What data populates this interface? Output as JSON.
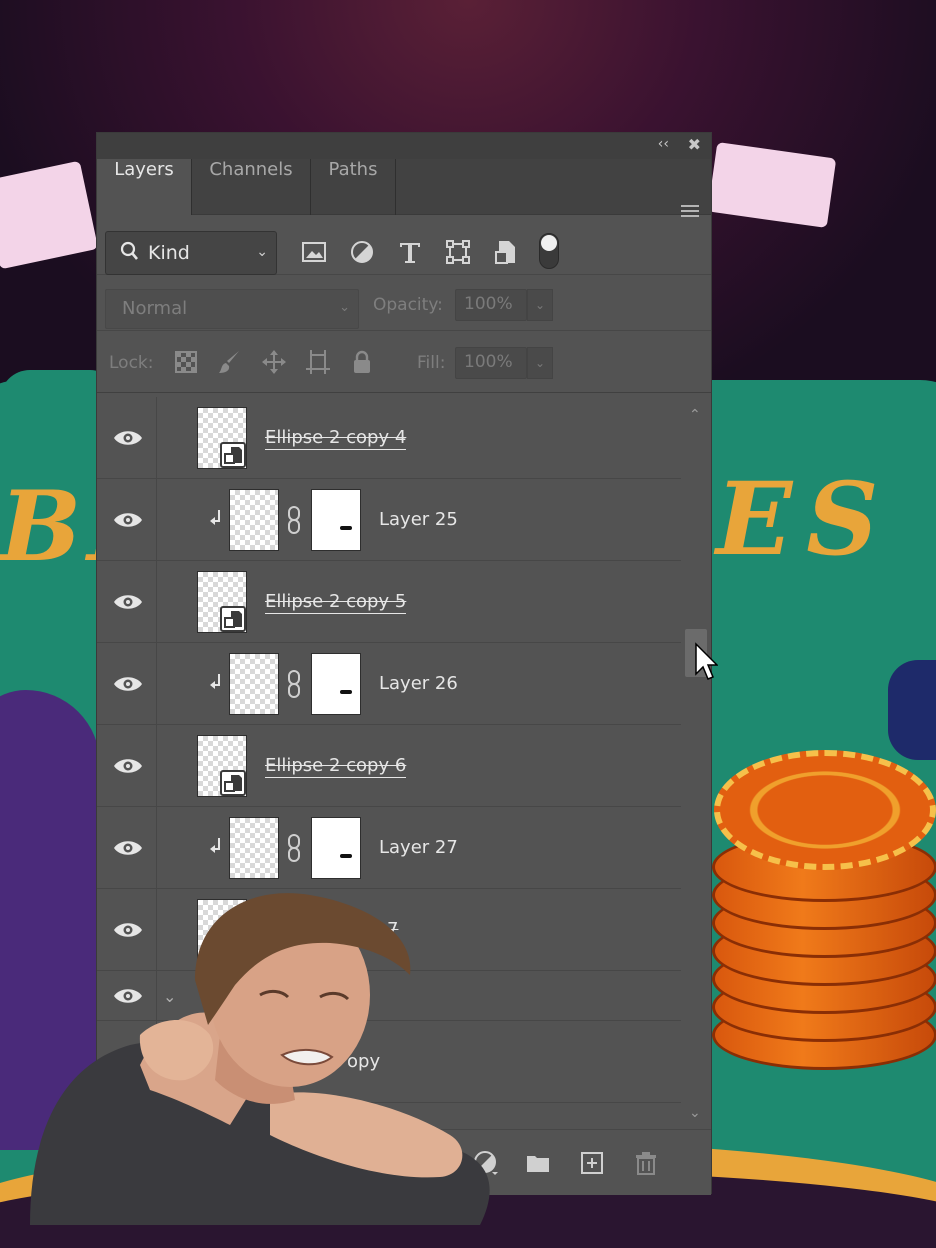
{
  "panel": {
    "collapse_glyph": "‹‹",
    "close_glyph": "✖",
    "tabs": [
      {
        "label": "Layers",
        "active": true
      },
      {
        "label": "Channels",
        "active": false
      },
      {
        "label": "Paths",
        "active": false
      }
    ],
    "menu_icon": "hamburger-menu-icon"
  },
  "filter": {
    "kind_label": "Kind",
    "icons": [
      "image-filter-icon",
      "adjustment-filter-icon",
      "type-filter-icon",
      "shape-filter-icon",
      "smartobject-filter-icon",
      "filter-toggle-icon"
    ]
  },
  "blend": {
    "mode": "Normal",
    "opacity_label": "Opacity:",
    "opacity_value": "100%"
  },
  "lock": {
    "label": "Lock:",
    "icons": [
      "lock-transparent-icon",
      "lock-pixels-icon",
      "lock-position-icon",
      "lock-artboard-icon",
      "lock-all-icon"
    ],
    "fill_label": "Fill:",
    "fill_value": "100%"
  },
  "layers": [
    {
      "name": "Ellipse 2 copy 4",
      "type": "smart-object",
      "disabled_effects": true
    },
    {
      "name": "Layer 25",
      "type": "clipped-masked"
    },
    {
      "name": "Ellipse 2 copy 5",
      "type": "smart-object",
      "disabled_effects": true
    },
    {
      "name": "Layer 26",
      "type": "clipped-masked"
    },
    {
      "name": "Ellipse 2 copy 6",
      "type": "smart-object",
      "disabled_effects": true
    },
    {
      "name": "Layer 27",
      "type": "clipped-masked"
    },
    {
      "name": "7",
      "type": "smart-object",
      "disabled_effects": true,
      "partially_hidden": true
    },
    {
      "name": "",
      "type": "group",
      "expanded": true
    },
    {
      "name": "opy",
      "type": "layer",
      "partially_hidden": true
    }
  ],
  "bottom_toolbar": {
    "icons": [
      "link-layers-icon",
      "fx-icon",
      "add-mask-icon",
      "adjustment-layer-icon",
      "new-group-icon",
      "new-layer-icon",
      "trash-icon"
    ]
  },
  "colors": {
    "panel_bg": "#535353",
    "tab_bar_bg": "#424242",
    "felt_green": "#1e8a70",
    "gold": "#e8a53a",
    "chip_orange": "#e25f10"
  }
}
